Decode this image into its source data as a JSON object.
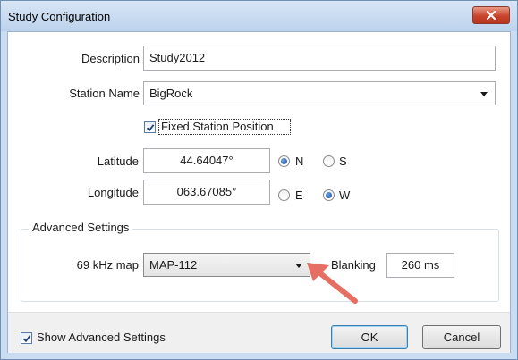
{
  "window": {
    "title": "Study Configuration"
  },
  "icons": {
    "close": "close-x-icon",
    "dropdown": "chevron-down-icon",
    "check": "checkmark-icon",
    "arrow": "red-pointer-arrow"
  },
  "colors": {
    "close_button": "#c8442c",
    "pointer_arrow": "#e46f62",
    "radio_selected": "#1f4f99"
  },
  "form": {
    "description": {
      "label": "Description",
      "value": "Study2012"
    },
    "station_name": {
      "label": "Station Name",
      "value": "BigRock"
    },
    "fixed_station": {
      "label": "Fixed Station Position",
      "checked": true
    },
    "latitude": {
      "label": "Latitude",
      "value": "44.64047°",
      "n_label": "N",
      "s_label": "S",
      "selected": "N"
    },
    "longitude": {
      "label": "Longitude",
      "value": "063.67085°",
      "e_label": "E",
      "w_label": "W",
      "selected": "W"
    }
  },
  "advanced": {
    "title": "Advanced Settings",
    "map_label": "69 kHz map",
    "map_value": "MAP-112",
    "blanking_label": "Blanking",
    "blanking_value": "260 ms"
  },
  "footer": {
    "show_advanced_label": "Show Advanced Settings",
    "show_advanced_checked": true,
    "ok_label": "OK",
    "cancel_label": "Cancel"
  }
}
